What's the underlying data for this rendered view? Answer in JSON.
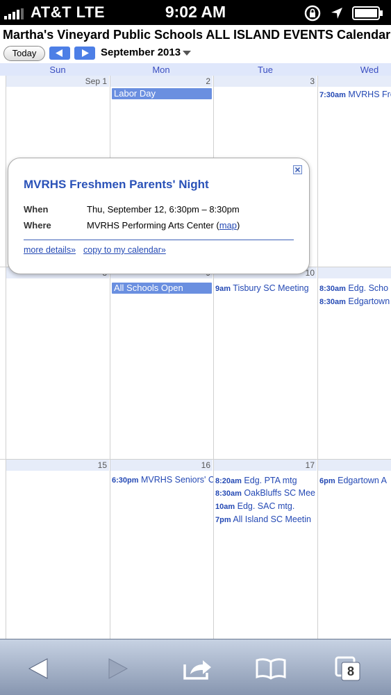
{
  "status": {
    "carrier": "AT&T  LTE",
    "time": "9:02 AM"
  },
  "calendar_title": "Martha's Vineyard Public Schools ALL ISLAND EVENTS Calendar",
  "toolbar": {
    "today_label": "Today",
    "month": "September 2013"
  },
  "days_of_week": [
    "Sun",
    "Mon",
    "Tue",
    "Wed"
  ],
  "weeks": [
    {
      "days": [
        {
          "num": "Sep 1",
          "events": []
        },
        {
          "num": "2",
          "allday": "Labor Day",
          "events": []
        },
        {
          "num": "3",
          "events": []
        },
        {
          "num": "",
          "events": [
            {
              "time": "7:30am",
              "title": "MVRHS Fre"
            }
          ]
        }
      ]
    },
    {
      "days": [
        {
          "num": "8",
          "events": []
        },
        {
          "num": "9",
          "allday": "All Schools Open",
          "events": []
        },
        {
          "num": "10",
          "events": [
            {
              "time": "9am",
              "title": "Tisbury SC Meeting"
            }
          ]
        },
        {
          "num": "",
          "events": [
            {
              "time": "8:30am",
              "title": "Edg. Scho"
            },
            {
              "time": "8:30am",
              "title": "Edgartown"
            }
          ]
        }
      ]
    },
    {
      "days": [
        {
          "num": "15",
          "events": []
        },
        {
          "num": "16",
          "events": [
            {
              "time": "6:30pm",
              "title": "MVRHS Seniors' C"
            }
          ]
        },
        {
          "num": "17",
          "events": [
            {
              "time": "8:20am",
              "title": "Edg. PTA mtg"
            },
            {
              "time": "8:30am",
              "title": "OakBluffs SC Mee"
            },
            {
              "time": "10am",
              "title": "Edg. SAC mtg."
            },
            {
              "time": "7pm",
              "title": "All Island SC Meetin"
            }
          ]
        },
        {
          "num": "",
          "events": [
            {
              "time": "6pm",
              "title": "Edgartown A"
            }
          ]
        }
      ]
    }
  ],
  "popup": {
    "title": "MVRHS Freshmen Parents' Night",
    "when_label": "When",
    "when_value": "Thu, September 12, 6:30pm – 8:30pm",
    "where_label": "Where",
    "where_value": "MVRHS Performing Arts Center (",
    "map_link": "map",
    "where_close": ")",
    "more_details": "more details»",
    "copy_link": "copy to my calendar»"
  },
  "bottombar": {
    "tabs_count": "8"
  }
}
